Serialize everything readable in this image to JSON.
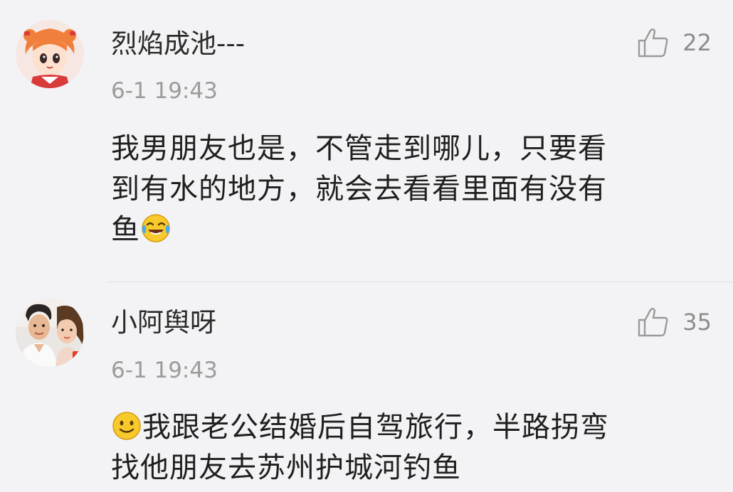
{
  "comments": [
    {
      "username": "烈焰成池---",
      "timestamp": "6-1 19:43",
      "likes": "22",
      "text_line1": "我男朋友也是，不管走到哪儿，只要看",
      "text_line2": "到有水的地方，就会去看看里面有没有",
      "text_line3": "鱼",
      "emoji": "laugh-cry-emoji"
    },
    {
      "username": "小阿舆呀",
      "timestamp": "6-1 19:43",
      "likes": "35",
      "emoji": "smile-emoji",
      "text_line1": "我跟老公结婚后自驾旅行，半路拐弯",
      "text_line2": "找他朋友去苏州护城河钓鱼"
    }
  ],
  "icons": {
    "like": "thumbs-up-icon"
  },
  "colors": {
    "background": "#f3f3f5",
    "username": "#2b2b2b",
    "timestamp": "#9b9b9b",
    "like_icon": "#9a9a9a"
  }
}
